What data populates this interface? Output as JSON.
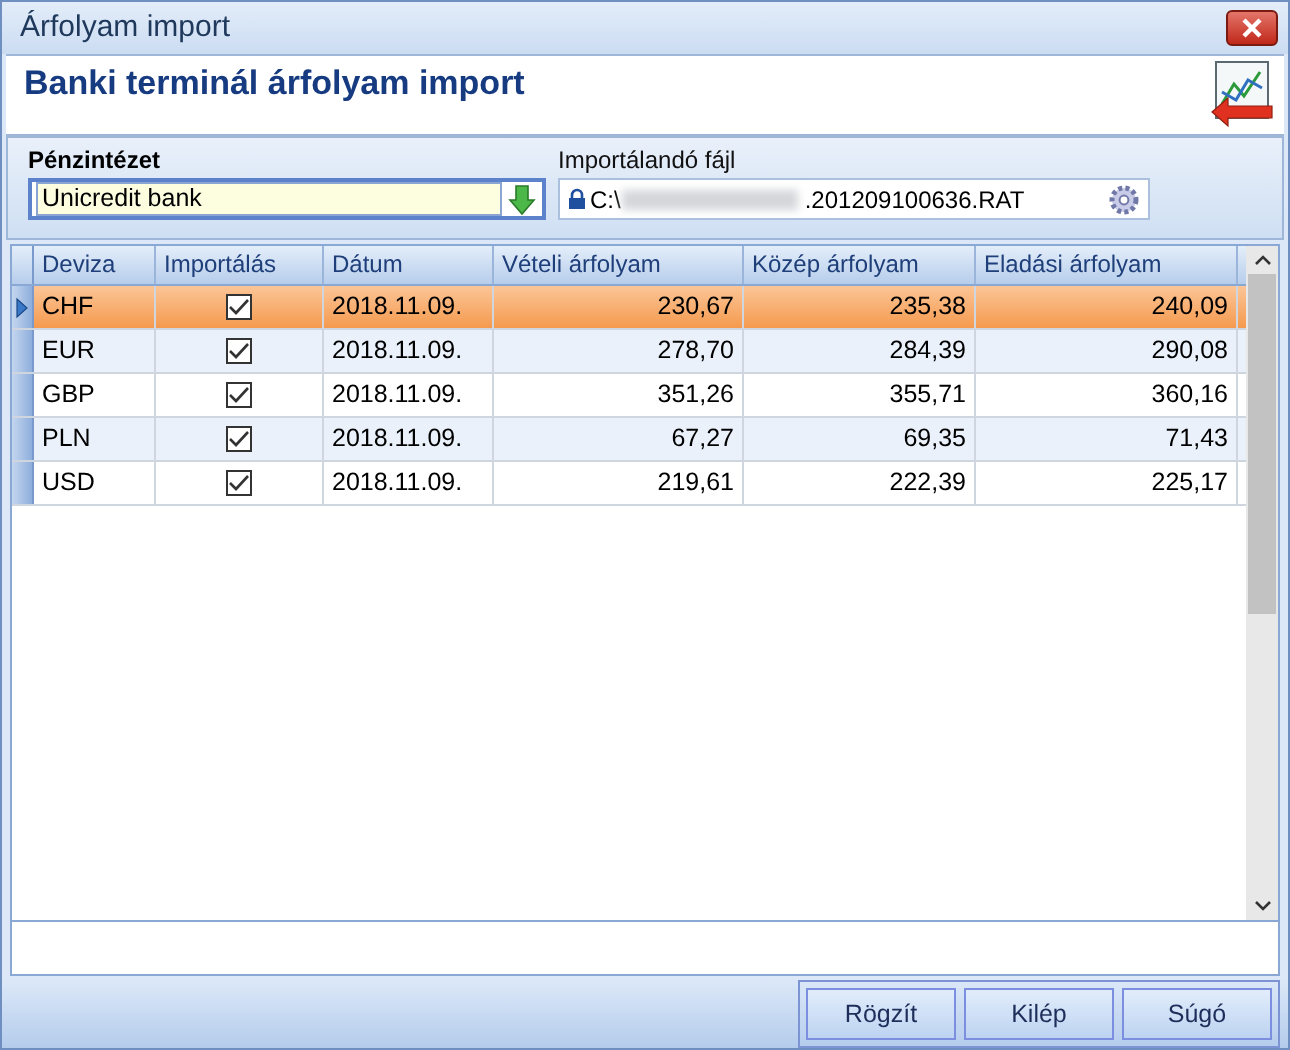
{
  "window": {
    "title": "Árfolyam import"
  },
  "header": {
    "title": "Banki terminál árfolyam import"
  },
  "filter": {
    "bank_label": "Pénzintézet",
    "bank_value": "Unicredit bank",
    "file_label": "Importálandó fájl",
    "file_start": "C:\\",
    "file_end": ".201209100636.RAT"
  },
  "table": {
    "columns": [
      "Deviza",
      "Importálás",
      "Dátum",
      "Vételi árfolyam",
      "Közép árfolyam",
      "Eladási árfolyam"
    ],
    "rows": [
      {
        "selected": true,
        "currency": "CHF",
        "checked": true,
        "date": "2018.11.09.",
        "buy": "230,67",
        "mid": "235,38",
        "sell": "240,09"
      },
      {
        "selected": false,
        "currency": "EUR",
        "checked": true,
        "date": "2018.11.09.",
        "buy": "278,70",
        "mid": "284,39",
        "sell": "290,08"
      },
      {
        "selected": false,
        "currency": "GBP",
        "checked": true,
        "date": "2018.11.09.",
        "buy": "351,26",
        "mid": "355,71",
        "sell": "360,16"
      },
      {
        "selected": false,
        "currency": "PLN",
        "checked": true,
        "date": "2018.11.09.",
        "buy": "67,27",
        "mid": "69,35",
        "sell": "71,43"
      },
      {
        "selected": false,
        "currency": "USD",
        "checked": true,
        "date": "2018.11.09.",
        "buy": "219,61",
        "mid": "222,39",
        "sell": "225,17"
      }
    ]
  },
  "buttons": [
    "Rögzít",
    "Kilép",
    "Súgó"
  ]
}
